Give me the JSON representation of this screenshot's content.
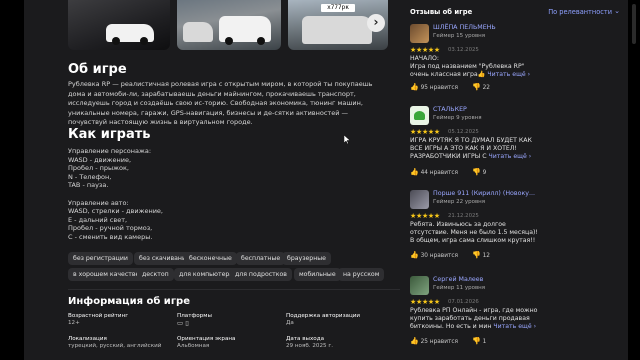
{
  "about": {
    "title": "Об игре",
    "text": "Рублевка RP — реалистичная ролевая игра с открытым миром, в которой ты покупаешь дома и автомоби-ли, зарабатываешь деньги майнингом, прокачиваешь транспорт, исследуешь город и создаёшь свою ис-торию. Свободная экономика, тюнинг машин, уникальные номера, гаражи, GPS-навигация, бизнесы и де-сятки активностей — почувствуй настоящую жизнь в виртуальном городе."
  },
  "screenshots": {
    "plate": "x777рк"
  },
  "howto": {
    "title": "Как играть",
    "text": "Управление персонажа:\nWASD - движение,\nПробел - прыжок,\nN - Телефон,\nTAB - пауза.\n\nУправление авто:\nWASD, стрелки - движение,\nE - дальний свет,\nПробел - ручной тормоз,\nC - сменить вид камеры."
  },
  "tags": [
    "без регистрации",
    "без скачивания",
    "бесконечные",
    "бесплатные",
    "браузерные",
    "в хорошем качестве",
    "десктоп",
    "для компьютера",
    "для подростков",
    "мобильные",
    "на русском"
  ],
  "info": {
    "title": "Информация об игре",
    "age_label": "Возрастной рейтинг",
    "age_value": "12+",
    "platforms_label": "Платформы",
    "auth_label": "Поддержка авторизации",
    "auth_value": "Да",
    "lang_label": "Локализация",
    "lang_value": "турецкий, русский, английский",
    "orient_label": "Ориентация экрана",
    "orient_value": "Альбомная",
    "date_label": "Дата выхода",
    "date_value": "29 нояб. 2025 г."
  },
  "reviews": {
    "title": "Отзывы об игре",
    "sort": "По релевантности",
    "items": [
      {
        "name": "ШЛЁПА ПЕЛЬМЕНЬ",
        "level": "Геймер 15 уровня",
        "stars": "★★★★★",
        "date": "03.12.2025",
        "text": "НАЧАЛО:\nИгра под названием \"Рублевка RP\" очень классная игра👍",
        "more": "Читать ещё",
        "up": "95 нравится",
        "down": "22"
      },
      {
        "name": "СТАЛЬКЕР",
        "level": "Геймер 9 уровня",
        "stars": "★★★★★",
        "date": "05.12.2025",
        "text": "ИГРА КРУТЯК Я ТО ДУМАЛ БУДЕТ КАК ВСЕ ИГРЫ А ЭТО КАК Я И ХОТЕЛ! РАЗРАБОТЧИКИ ИГРЫ С",
        "more": "Читать ещё",
        "up": "44 нравится",
        "down": "9"
      },
      {
        "name": "Порше 911 (Кирилл) (Новоку...",
        "level": "Геймер 22 уровня",
        "stars": "★★★★★",
        "date": "21.12.2025",
        "text": "Ребята. Извиньюсь за долгое отсутствие. Меня не было 1.5 месяца)! В общем, игра сама слишком крутая!!",
        "more": "",
        "up": "30 нравится",
        "down": "12"
      },
      {
        "name": "Сергей Малеев",
        "level": "Геймер 11 уровня",
        "stars": "★★★★★",
        "date": "07.01.2026",
        "text": "Рублевка РП Онлайн - игра, где можно купить заработать деньги продавая биткоины. Но есть и мин",
        "more": "Читать ещё",
        "up": "25 нравится",
        "down": "1"
      }
    ]
  }
}
